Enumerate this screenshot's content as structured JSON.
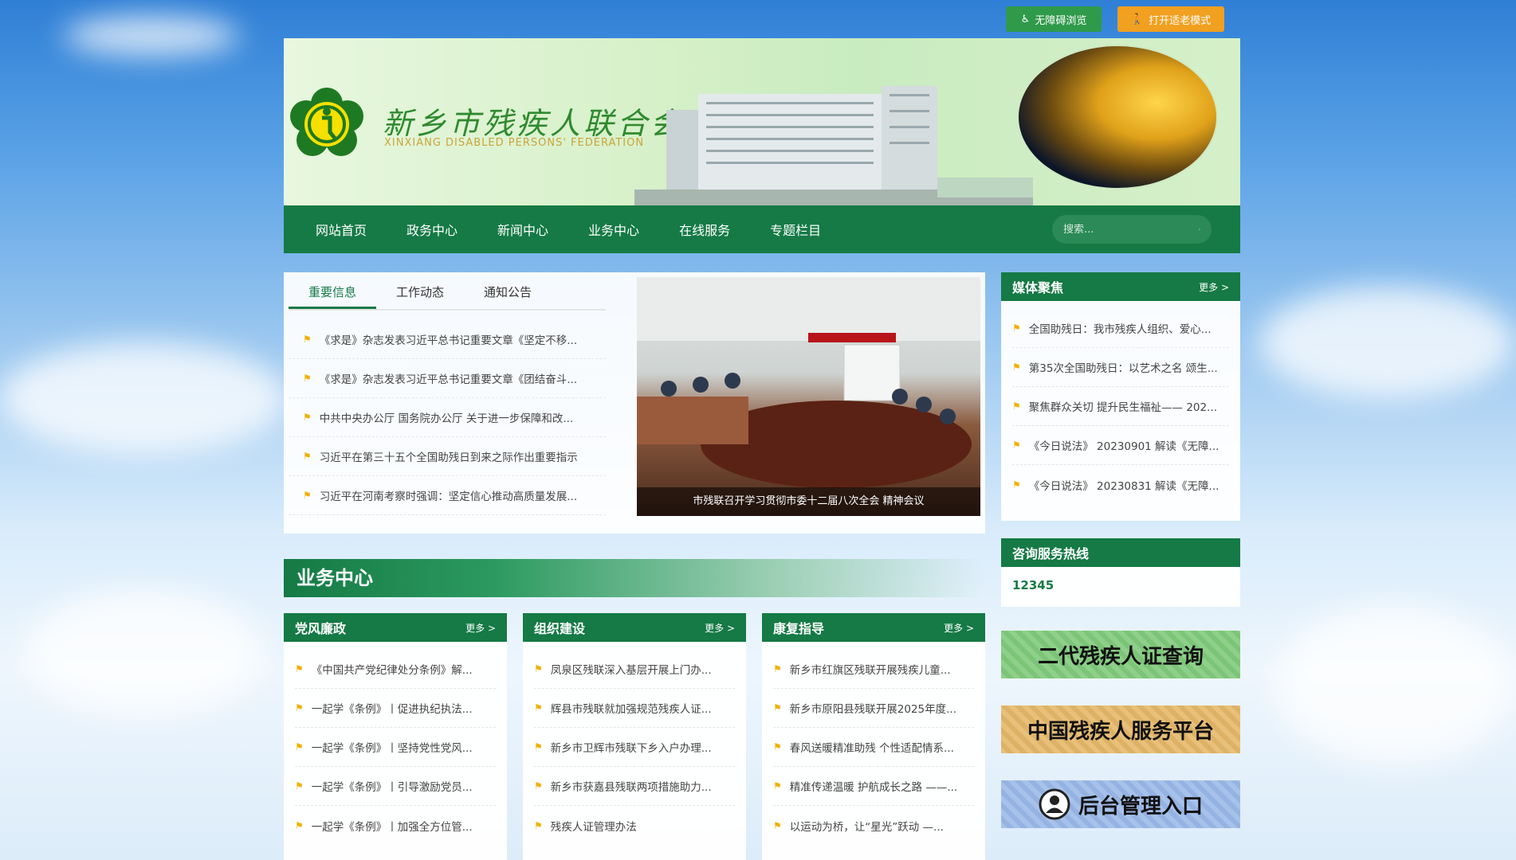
{
  "top_buttons": {
    "accessible": "无障碍浏览",
    "elder": "打开适老模式"
  },
  "header": {
    "title": "新乡市残疾人联合会",
    "subtitle": "XINXIANG DISABLED PERSONS' FEDERATION"
  },
  "nav": {
    "items": [
      "网站首页",
      "政务中心",
      "新闻中心",
      "业务中心",
      "在线服务",
      "专题栏目"
    ],
    "search_placeholder": "搜索..."
  },
  "news": {
    "tabs": [
      "重要信息",
      "工作动态",
      "通知公告"
    ],
    "items": [
      "《求是》杂志发表习近平总书记重要文章《坚定不移...",
      "《求是》杂志发表习近平总书记重要文章《团结奋斗...",
      "中共中央办公厅 国务院办公厅 关于进一步保障和改...",
      "习近平在第三十五个全国助残日到来之际作出重要指示",
      "习近平在河南考察时强调：坚定信心推动高质量发展..."
    ],
    "photo_caption": "市残联召开学习贯彻市委十二届八次全会 精神会议"
  },
  "media": {
    "title": "媒体聚焦",
    "more": "更多 >",
    "items": [
      "全国助残日：我市残疾人组织、爱心...",
      "第35次全国助残日：以艺术之名 颂生...",
      "聚焦群众关切 提升民生福祉—— 202...",
      "《今日说法》 20230901 解读《无障...",
      "《今日说法》 20230831 解读《无障..."
    ]
  },
  "hotline": {
    "title": "咨询服务热线",
    "number": "12345"
  },
  "links": {
    "card_query": "二代残疾人证查询",
    "service_platform": "中国残疾人服务平台",
    "admin": "后台管理入口"
  },
  "business": {
    "title": "业务中心",
    "columns": [
      {
        "title": "党风廉政",
        "more": "更多 >",
        "items": [
          "《中国共产党纪律处分条例》解...",
          "一起学《条例》丨促进执纪执法...",
          "一起学《条例》丨坚持党性党风...",
          "一起学《条例》丨引导激励党员...",
          "一起学《条例》丨加强全方位管..."
        ]
      },
      {
        "title": "组织建设",
        "more": "更多 >",
        "items": [
          "凤泉区残联深入基层开展上门办...",
          "辉县市残联就加强规范残疾人证...",
          "新乡市卫辉市残联下乡入户办理...",
          "新乡市获嘉县残联两项措施助力...",
          "残疾人证管理办法"
        ]
      },
      {
        "title": "康复指导",
        "more": "更多 >",
        "items": [
          "新乡市红旗区残联开展残疾儿童...",
          "新乡市原阳县残联开展2025年度...",
          "春风送暖精准助残 个性适配情系...",
          "精准传递温暖 护航成长之路 ——...",
          "以运动为桥，让“星光”跃动 —..."
        ]
      }
    ]
  },
  "colors": {
    "primary_green": "#157a45",
    "elder_orange": "#f1a01f",
    "accessible_green": "#2f9a4a",
    "flag_yellow": "#f0b000"
  }
}
